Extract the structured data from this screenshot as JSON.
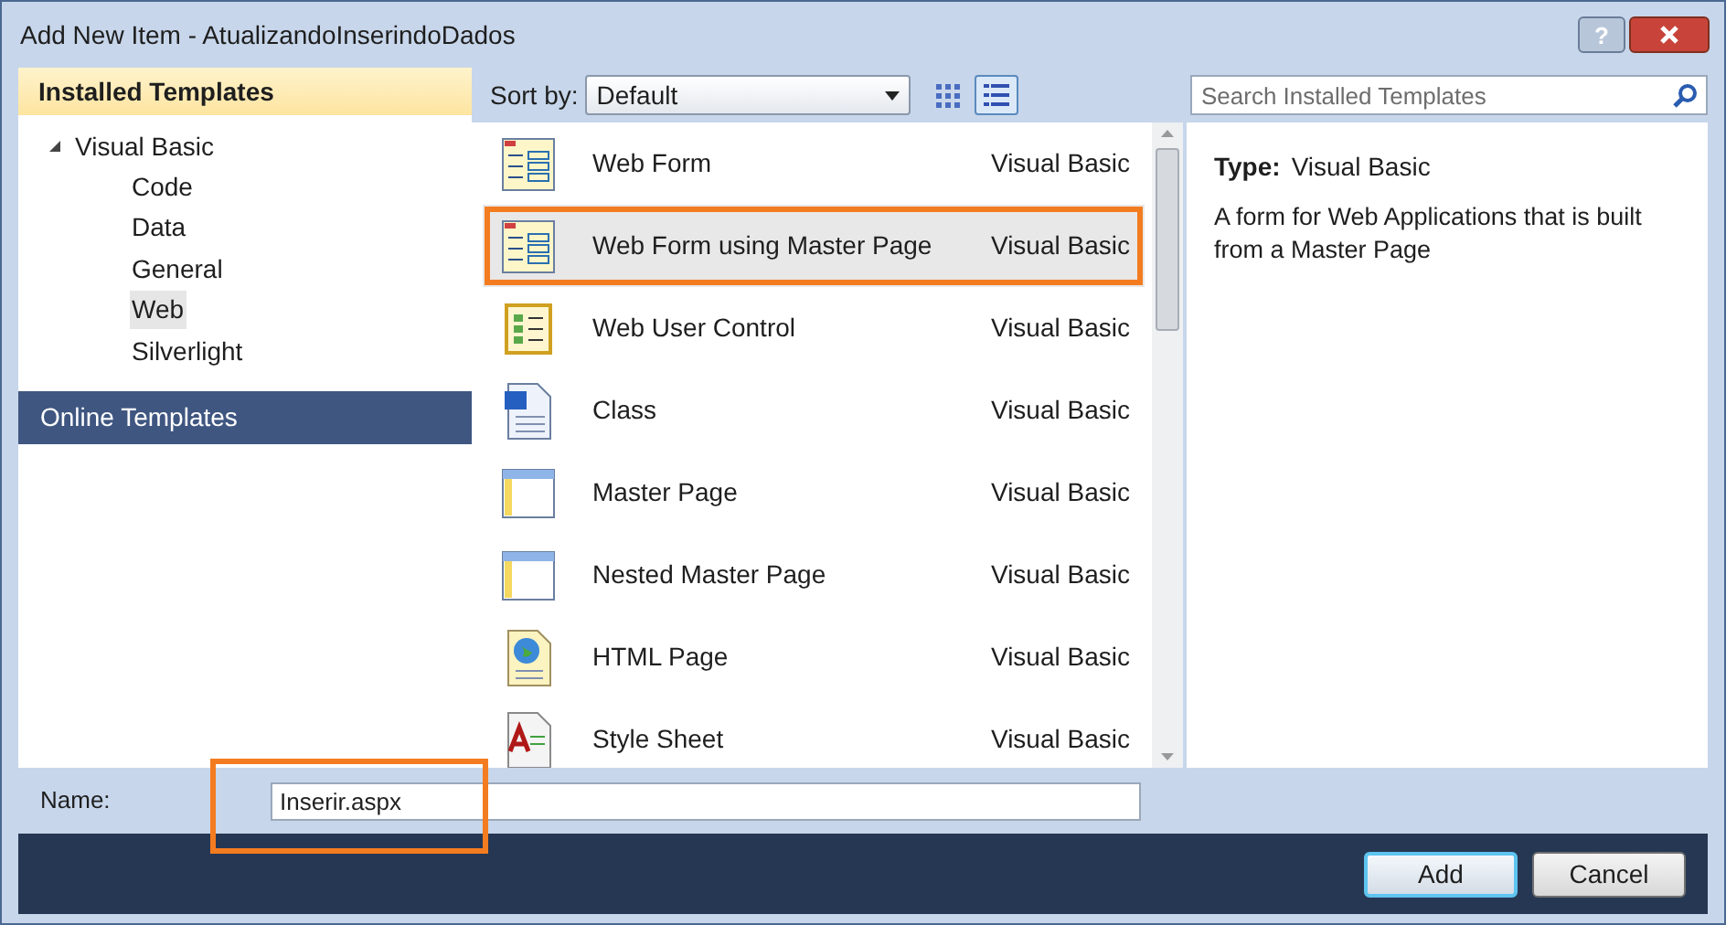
{
  "window": {
    "title": "Add New Item - AtualizandoInserindoDados",
    "help": "?"
  },
  "sidebar": {
    "header": "Installed Templates",
    "tree": [
      {
        "label": "Visual Basic",
        "expanded": true,
        "selected": false,
        "children": [
          {
            "label": "Code",
            "selected": false
          },
          {
            "label": "Data",
            "selected": false
          },
          {
            "label": "General",
            "selected": false
          },
          {
            "label": "Web",
            "selected": true
          },
          {
            "label": "Silverlight",
            "selected": false
          }
        ]
      }
    ],
    "online": "Online Templates"
  },
  "toolbar": {
    "sort_label": "Sort by:",
    "sort_value": "Default",
    "views": [
      {
        "kind": "small",
        "selected": false
      },
      {
        "kind": "list",
        "selected": true
      }
    ],
    "search": {
      "placeholder": "Search Installed Templates"
    }
  },
  "templates": [
    {
      "name": "Web Form",
      "language": "Visual Basic",
      "kind": "form",
      "selected": false
    },
    {
      "name": "Web Form using Master Page",
      "language": "Visual Basic",
      "kind": "form",
      "selected": true
    },
    {
      "name": "Web User Control",
      "language": "Visual Basic",
      "kind": "control",
      "selected": false
    },
    {
      "name": "Class",
      "language": "Visual Basic",
      "kind": "class",
      "selected": false
    },
    {
      "name": "Master Page",
      "language": "Visual Basic",
      "kind": "master",
      "selected": false
    },
    {
      "name": "Nested Master Page",
      "language": "Visual Basic",
      "kind": "master",
      "selected": false
    },
    {
      "name": "HTML Page",
      "language": "Visual Basic",
      "kind": "html",
      "selected": false
    },
    {
      "name": "Style Sheet",
      "language": "Visual Basic",
      "kind": "css",
      "selected": false
    }
  ],
  "details": {
    "type_label": "Type:",
    "type_value": "Visual Basic",
    "description": "A form for Web Applications that is built from a Master Page"
  },
  "name_field": {
    "label": "Name:",
    "value": "Inserir.aspx"
  },
  "buttons": [
    {
      "label": "Add",
      "default": true
    },
    {
      "label": "Cancel",
      "default": false
    }
  ]
}
